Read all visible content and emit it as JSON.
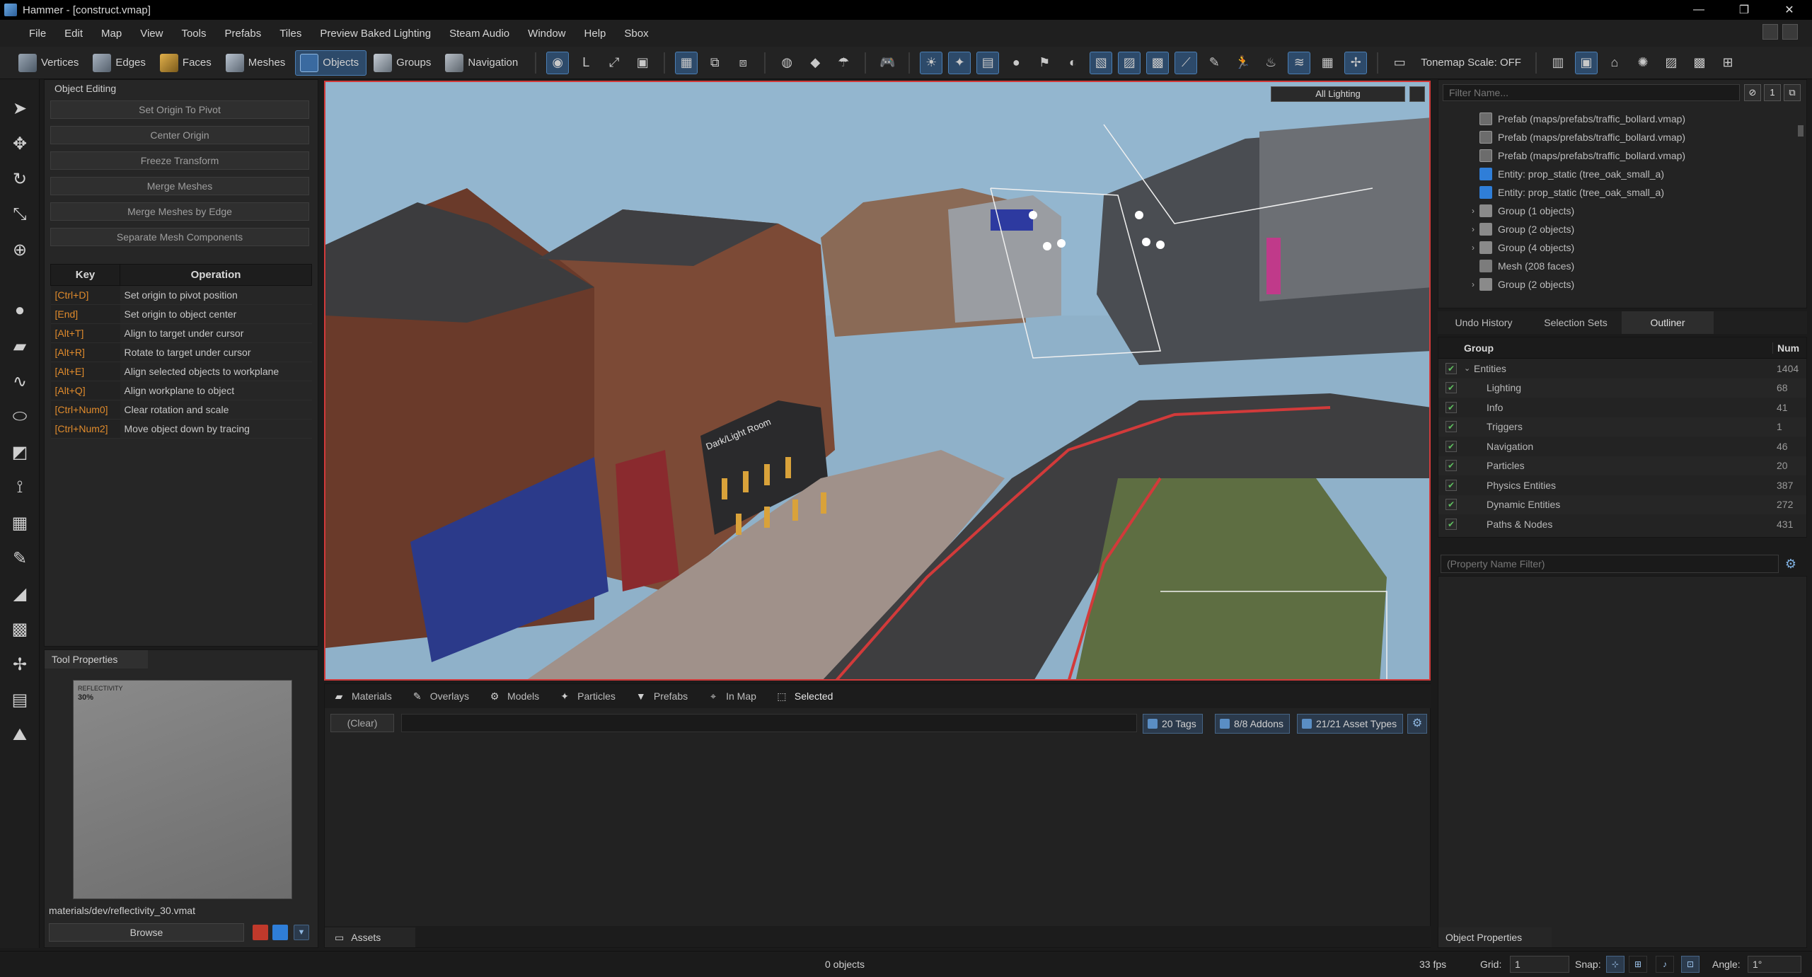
{
  "window": {
    "title": "Hammer - [construct.vmap]"
  },
  "menu": [
    "File",
    "Edit",
    "Map",
    "View",
    "Tools",
    "Prefabs",
    "Tiles",
    "Preview Baked Lighting",
    "Steam Audio",
    "Window",
    "Help",
    "Sbox"
  ],
  "toolbar": {
    "modes": [
      {
        "label": "Vertices",
        "icon": "vertices-icon",
        "active": false
      },
      {
        "label": "Edges",
        "icon": "edges-icon",
        "active": false
      },
      {
        "label": "Faces",
        "icon": "faces-icon",
        "active": false
      },
      {
        "label": "Meshes",
        "icon": "meshes-icon",
        "active": false
      },
      {
        "label": "Objects",
        "icon": "objects-icon",
        "active": true
      },
      {
        "label": "Groups",
        "icon": "groups-icon",
        "active": false
      },
      {
        "label": "Navigation",
        "icon": "navigation-icon",
        "active": false
      }
    ],
    "tonemap_label": "Tonemap Scale: OFF"
  },
  "object_editing": {
    "title": "Object Editing",
    "buttons": [
      "Set Origin To Pivot",
      "Center Origin",
      "Freeze Transform",
      "Merge Meshes",
      "Merge Meshes by Edge",
      "Separate Mesh Components"
    ],
    "table_headers": {
      "key": "Key",
      "operation": "Operation"
    },
    "shortcuts": [
      {
        "key": "[Ctrl+D]",
        "op": "Set origin to pivot position"
      },
      {
        "key": "[End]",
        "op": "Set origin to object center"
      },
      {
        "key": "[Alt+T]",
        "op": "Align to target under cursor"
      },
      {
        "key": "[Alt+R]",
        "op": "Rotate to target under cursor"
      },
      {
        "key": "[Alt+E]",
        "op": "Align selected objects to workplane"
      },
      {
        "key": "[Alt+Q]",
        "op": "Align workplane to object"
      },
      {
        "key": "[Ctrl+Num0]",
        "op": "Clear rotation and scale"
      },
      {
        "key": "[Ctrl+Num2]",
        "op": "Move object down by tracing"
      }
    ]
  },
  "tool_properties": {
    "tab": "Tool Properties",
    "preview_tag": "REFLECTIVITY",
    "preview_value": "30%",
    "material_path": "materials/dev/reflectivity_30.vmat",
    "browse_label": "Browse"
  },
  "viewport": {
    "lighting_button": "All Lighting",
    "sign_text": "Dark/Light Room"
  },
  "asset_browser": {
    "tabs": [
      {
        "label": "Materials",
        "icon": "materials-icon"
      },
      {
        "label": "Overlays",
        "icon": "overlays-icon"
      },
      {
        "label": "Models",
        "icon": "models-icon"
      },
      {
        "label": "Particles",
        "icon": "particles-icon"
      },
      {
        "label": "Prefabs",
        "icon": "prefabs-icon"
      },
      {
        "label": "In Map",
        "icon": "in-map-icon"
      },
      {
        "label": "Selected",
        "icon": "selected-icon"
      }
    ],
    "clear_label": "(Clear)",
    "tags_label": "20 Tags",
    "addons_label": "8/8 Addons",
    "asset_types_label": "21/21 Asset Types",
    "bottom_tab": "Assets"
  },
  "hierarchy": {
    "filter_placeholder": "Filter Name...",
    "items": [
      {
        "label": "Prefab (maps/prefabs/traffic_bollard.vmap)",
        "type": "prefab",
        "expandable": false
      },
      {
        "label": "Prefab (maps/prefabs/traffic_bollard.vmap)",
        "type": "prefab",
        "expandable": false
      },
      {
        "label": "Prefab (maps/prefabs/traffic_bollard.vmap)",
        "type": "prefab",
        "expandable": false
      },
      {
        "label": "Entity: prop_static (tree_oak_small_a)",
        "type": "entity",
        "expandable": false
      },
      {
        "label": "Entity: prop_static (tree_oak_small_a)",
        "type": "entity",
        "expandable": false
      },
      {
        "label": "Group (1 objects)",
        "type": "group",
        "expandable": true
      },
      {
        "label": "Group (2 objects)",
        "type": "group",
        "expandable": true
      },
      {
        "label": "Group (4 objects)",
        "type": "group",
        "expandable": true
      },
      {
        "label": "Mesh (208 faces)",
        "type": "mesh",
        "expandable": false
      },
      {
        "label": "Group (2 objects)",
        "type": "group",
        "expandable": true
      }
    ]
  },
  "right_tabs": [
    {
      "label": "Undo History",
      "selected": false
    },
    {
      "label": "Selection Sets",
      "selected": false
    },
    {
      "label": "Outliner",
      "selected": true
    }
  ],
  "outliner": {
    "headers": {
      "group": "Group",
      "num": "Num"
    },
    "rows": [
      {
        "label": "Entities",
        "num": "1404",
        "indent": 0,
        "expanded": true
      },
      {
        "label": "Lighting",
        "num": "68",
        "indent": 1
      },
      {
        "label": "Info",
        "num": "41",
        "indent": 1
      },
      {
        "label": "Triggers",
        "num": "1",
        "indent": 1
      },
      {
        "label": "Navigation",
        "num": "46",
        "indent": 1
      },
      {
        "label": "Particles",
        "num": "20",
        "indent": 1
      },
      {
        "label": "Physics Entities",
        "num": "387",
        "indent": 1
      },
      {
        "label": "Dynamic Entities",
        "num": "272",
        "indent": 1
      },
      {
        "label": "Paths & Nodes",
        "num": "431",
        "indent": 1
      }
    ]
  },
  "object_properties": {
    "filter_placeholder": "(Property Name Filter)",
    "tab": "Object Properties"
  },
  "status": {
    "objects": "0 objects",
    "fps": "33 fps",
    "grid_label": "Grid:",
    "grid_value": "1",
    "snap_label": "Snap:",
    "angle_label": "Angle:",
    "angle_value": "1°"
  },
  "colors": {
    "accent": "#4b7fb5",
    "viewport_border": "#d23a3a",
    "shortcut_key": "#e08b2c"
  }
}
